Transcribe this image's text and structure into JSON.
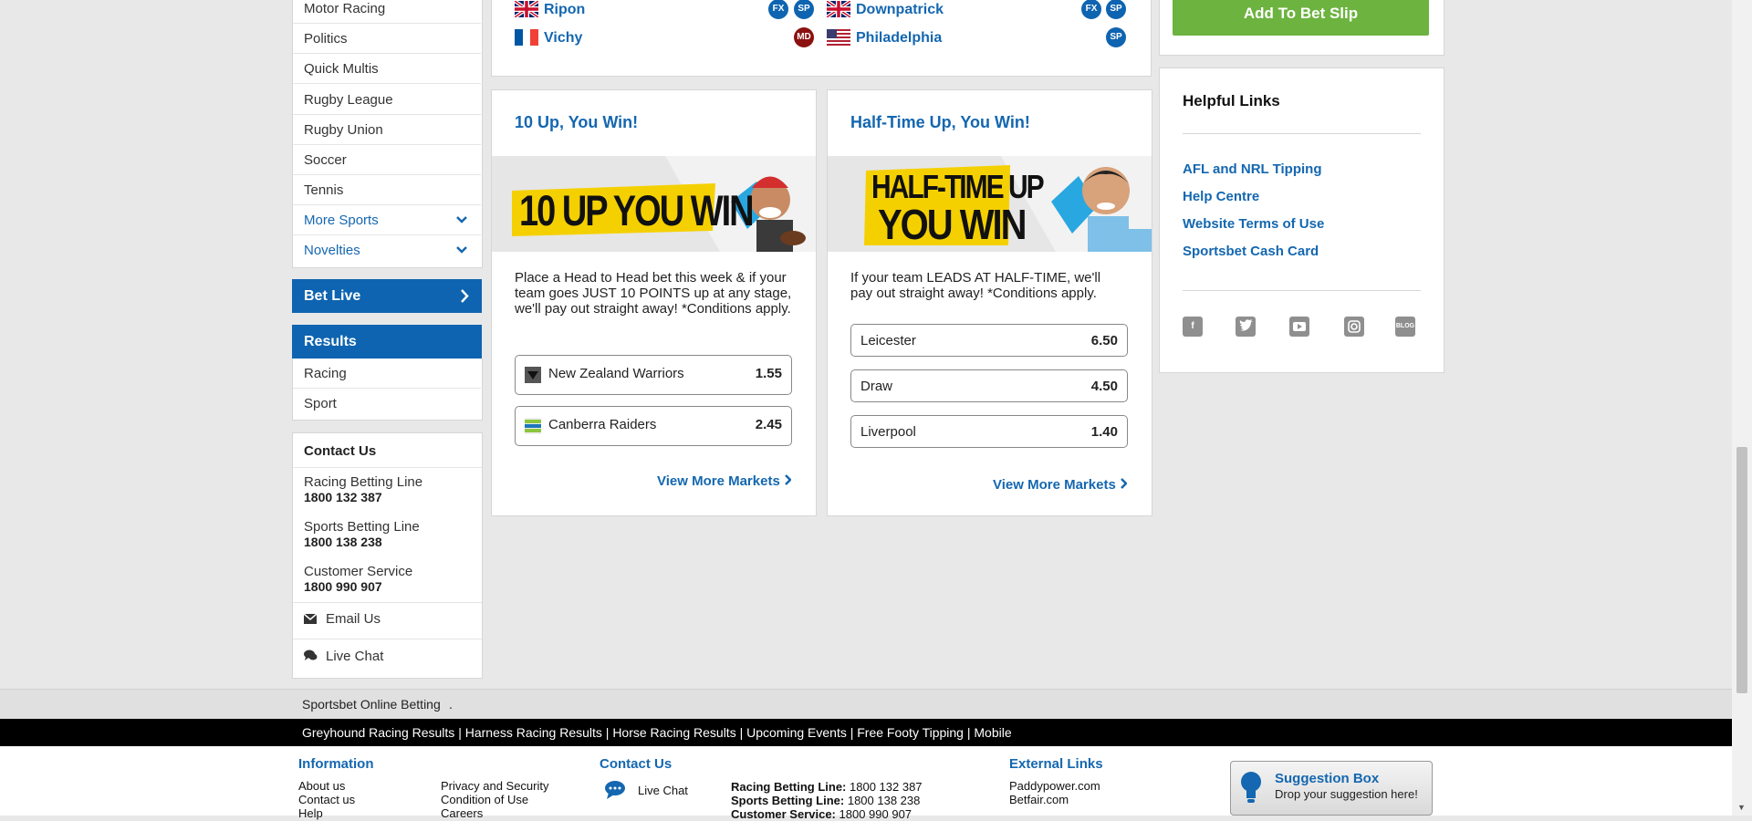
{
  "sidebar": {
    "sports_items": [
      {
        "label": "Motor Racing"
      },
      {
        "label": "Politics"
      },
      {
        "label": "Quick Multis"
      },
      {
        "label": "Rugby League"
      },
      {
        "label": "Rugby Union"
      },
      {
        "label": "Soccer"
      },
      {
        "label": "Tennis"
      }
    ],
    "more_sports": "More Sports",
    "novelties": "Novelties",
    "bet_live": "Bet Live",
    "results_title": "Results",
    "results_items": [
      {
        "label": "Racing"
      },
      {
        "label": "Sport"
      }
    ],
    "contact": {
      "title": "Contact Us",
      "racing_label": "Racing Betting Line",
      "racing_number": "1800 132 387",
      "sports_label": "Sports Betting Line",
      "sports_number": "1800 138 238",
      "service_label": "Customer Service",
      "service_number": "1800 990 907",
      "email": "Email Us",
      "chat": "Live Chat"
    }
  },
  "races": [
    {
      "name": "Ripon",
      "badges": [
        "FX",
        "SP"
      ]
    },
    {
      "name": "Downpatrick",
      "badges": [
        "FX",
        "SP"
      ]
    },
    {
      "name": "Vichy",
      "badges": [
        "MD"
      ]
    },
    {
      "name": "Philadelphia",
      "badges": [
        "SP"
      ]
    }
  ],
  "promo_left": {
    "title": "10 Up, You Win!",
    "banner": "10 UP YOU WIN",
    "description": "Place a Head to Head bet this week & if your team goes JUST 10 POINTS up at any stage, we'll pay out straight away! *Conditions apply.",
    "selections": [
      {
        "name": "New Zealand Warriors",
        "price": "1.55"
      },
      {
        "name": "Canberra Raiders",
        "price": "2.45"
      }
    ],
    "more": "View More Markets"
  },
  "promo_right": {
    "title": "Half-Time Up, You Win!",
    "banner_line1": "HALF-TIME UP",
    "banner_line2": "YOU WIN",
    "description": "If your team LEADS AT HALF-TIME, we'll pay out straight away! *Conditions apply.",
    "selections": [
      {
        "name": "Leicester",
        "price": "6.50"
      },
      {
        "name": "Draw",
        "price": "4.50"
      },
      {
        "name": "Liverpool",
        "price": "1.40"
      }
    ],
    "more": "View More Markets"
  },
  "betslip": {
    "add_button": "Add To Bet Slip"
  },
  "helpful": {
    "title": "Helpful Links",
    "links": [
      {
        "label": "AFL and NRL Tipping"
      },
      {
        "label": "Help Centre"
      },
      {
        "label": "Website Terms of Use"
      },
      {
        "label": "Sportsbet Cash Card"
      }
    ],
    "social_blog": "BLOG"
  },
  "footer": {
    "brand": "Sportsbet Online Betting",
    "brand_dot": ".",
    "links_bar": "Greyhound Racing Results | Harness Racing Results | Horse Racing Results | Upcoming Events | Free Footy Tipping | Mobile",
    "information_title": "Information",
    "info_col1": [
      "About us",
      "Contact us",
      "Help"
    ],
    "info_col2": [
      "Privacy and Security",
      "Condition of Use",
      "Careers"
    ],
    "contact_title": "Contact Us",
    "live_chat": "Live Chat",
    "racing_line_label": "Racing Betting Line:",
    "racing_line_number": "1800 132 387",
    "sports_line_label": "Sports Betting Line:",
    "sports_line_number": "1800 138 238",
    "service_label": "Customer Service:",
    "service_number": "1800 990 907",
    "external_title": "External Links",
    "external_links": [
      "Paddypower.com",
      "Betfair.com"
    ],
    "suggestion_title": "Suggestion Box",
    "suggestion_sub": "Drop your suggestion here!"
  },
  "colors": {
    "brand_blue": "#0e64b0",
    "link_blue": "#1467b0",
    "green": "#6cb33f",
    "banner_yellow": "#f5d000"
  }
}
